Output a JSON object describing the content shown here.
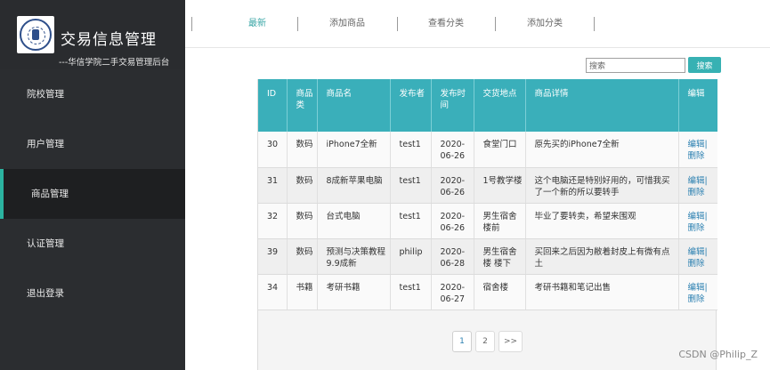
{
  "brand": {
    "title": "交易信息管理",
    "subtitle": "---华信学院二手交易管理后台"
  },
  "sidebar": {
    "items": [
      {
        "label": "院校管理",
        "active": false
      },
      {
        "label": "用户管理",
        "active": false
      },
      {
        "label": "商品管理",
        "active": true
      },
      {
        "label": "认证管理",
        "active": false
      },
      {
        "label": "退出登录",
        "active": false
      }
    ]
  },
  "tabs": [
    {
      "label": "最新",
      "active": true
    },
    {
      "label": "添加商品",
      "active": false
    },
    {
      "label": "查看分类",
      "active": false
    },
    {
      "label": "添加分类",
      "active": false
    }
  ],
  "search": {
    "placeholder": "搜索",
    "button_label": "搜索"
  },
  "table": {
    "headers": [
      "ID",
      "商品类",
      "商品名",
      "发布者",
      "发布时间",
      "交货地点",
      "商品详情",
      "编辑"
    ],
    "rows": [
      {
        "id": "30",
        "category": "数码",
        "name": "iPhone7全新",
        "publisher": "test1",
        "time": "2020-06-26",
        "place": "食堂门口",
        "detail": "原先买的iPhone7全新",
        "edit": "编辑|",
        "del": "删除"
      },
      {
        "id": "31",
        "category": "数码",
        "name": "8成新苹果电脑",
        "publisher": "test1",
        "time": "2020-06-26",
        "place": "1号教学楼",
        "detail": "这个电脑还是特别好用的，可惜我买了一个新的所以要转手",
        "edit": "编辑|",
        "del": "删除"
      },
      {
        "id": "32",
        "category": "数码",
        "name": "台式电脑",
        "publisher": "test1",
        "time": "2020-06-26",
        "place": "男生宿舍楼前",
        "detail": "毕业了要转卖，希望来围观",
        "edit": "编辑|",
        "del": "删除"
      },
      {
        "id": "39",
        "category": "数码",
        "name": "预测与决策教程 9.9成新",
        "publisher": "philip",
        "time": "2020-06-28",
        "place": "男生宿舍楼 楼下",
        "detail": "买回来之后因为敝着封皮上有微有点土",
        "edit": "编辑|",
        "del": "删除"
      },
      {
        "id": "34",
        "category": "书籍",
        "name": "考研书籍",
        "publisher": "test1",
        "time": "2020-06-27",
        "place": "宿舍楼",
        "detail": "考研书籍和笔记出售",
        "edit": "编辑|",
        "del": "删除"
      }
    ]
  },
  "pagination": {
    "pages": [
      "1",
      "2"
    ],
    "next": ">>"
  },
  "watermark": "CSDN @Philip_Z"
}
